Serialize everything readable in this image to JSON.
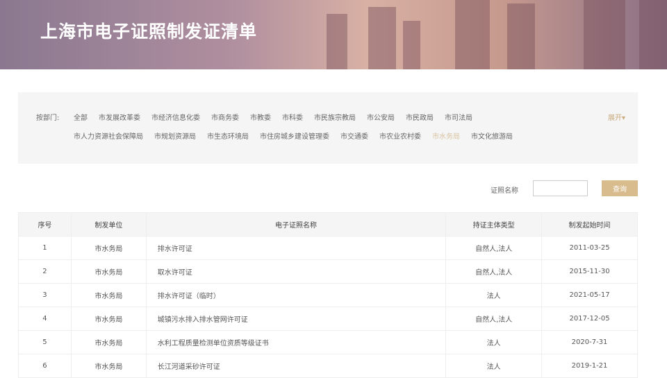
{
  "header": {
    "title": "上海市电子证照制发证清单"
  },
  "filter": {
    "label": "按部门:",
    "expand_label": "展开▾",
    "row1": [
      "全部",
      "市发展改革委",
      "市经济信息化委",
      "市商务委",
      "市教委",
      "市科委",
      "市民族宗教局",
      "市公安局",
      "市民政局",
      "市司法局"
    ],
    "row2": [
      "市人力资源社会保障局",
      "市规划资源局",
      "市生态环境局",
      "市住房城乡建设管理委",
      "市交通委",
      "市农业农村委",
      "市水务局",
      "市文化旅游局"
    ],
    "active": "市水务局"
  },
  "search": {
    "label": "证照名称",
    "value": "",
    "button": "查询"
  },
  "table": {
    "headers": [
      "序号",
      "制发单位",
      "电子证照名称",
      "持证主体类型",
      "制发起始时间"
    ],
    "rows": [
      [
        "1",
        "市水务局",
        "排水许可证",
        "自然人,法人",
        "2011-03-25"
      ],
      [
        "2",
        "市水务局",
        "取水许可证",
        "自然人,法人",
        "2015-11-30"
      ],
      [
        "3",
        "市水务局",
        "排水许可证（临时）",
        "法人",
        "2021-05-17"
      ],
      [
        "4",
        "市水务局",
        "城镇污水排入排水管网许可证",
        "自然人,法人",
        "2017-12-05"
      ],
      [
        "5",
        "市水务局",
        "水利工程质量检测单位资质等级证书",
        "法人",
        "2020-7-31"
      ],
      [
        "6",
        "市水务局",
        "长江河道采砂许可证",
        "法人",
        "2019-1-21"
      ]
    ]
  }
}
